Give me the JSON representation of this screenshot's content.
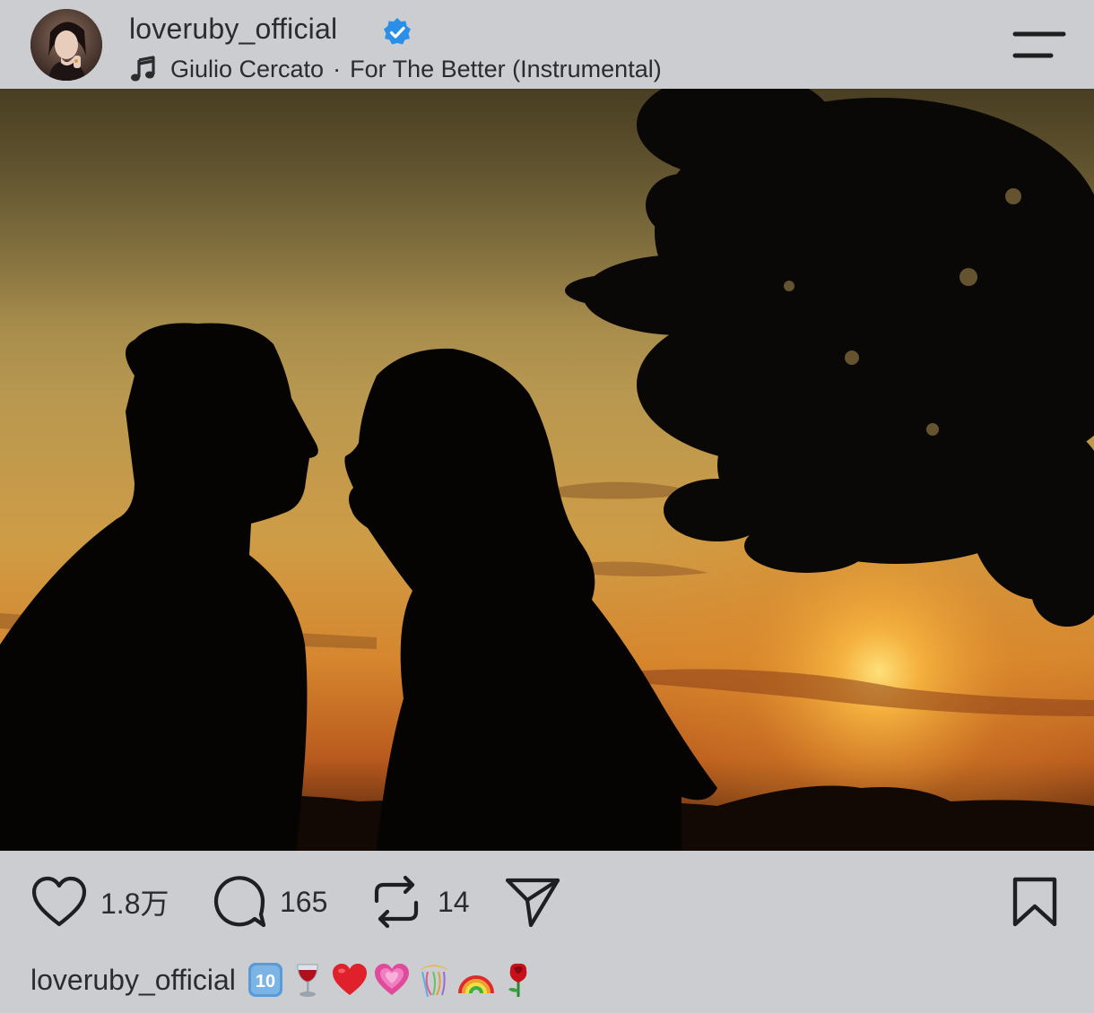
{
  "post": {
    "username": "loveruby_official",
    "verified": true,
    "music": {
      "artist": "Giulio Cercato",
      "separator": "·",
      "track": "For The Better (Instrumental)"
    }
  },
  "actions": {
    "likes": "1.8万",
    "comments": "165",
    "reposts": "14"
  },
  "caption": {
    "username": "loveruby_official",
    "emojis": [
      "keycap-ten",
      "wine-glass",
      "red-heart",
      "growing-heart",
      "confetti-ball",
      "rainbow",
      "rose"
    ]
  },
  "colors": {
    "background": "#cbcdd0",
    "text": "#2b2c2e",
    "verified_blue": "#2b8fe8"
  }
}
